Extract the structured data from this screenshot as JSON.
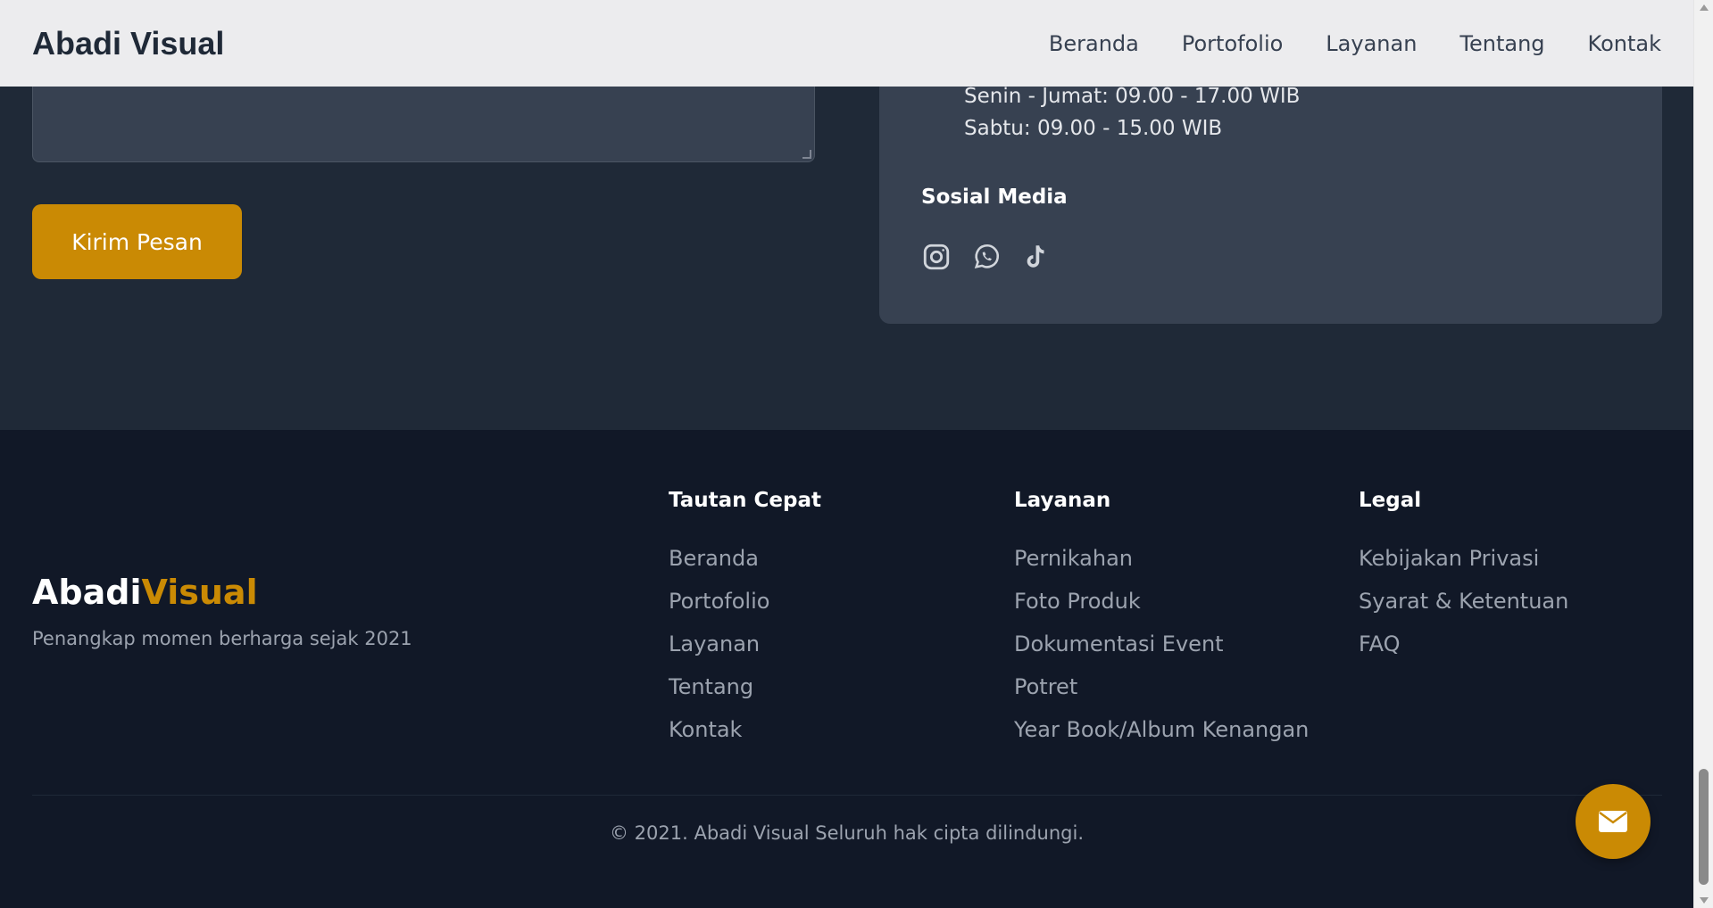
{
  "header": {
    "brand": "Abadi Visual",
    "nav": [
      "Beranda",
      "Portofolio",
      "Layanan",
      "Tentang",
      "Kontak"
    ]
  },
  "contact": {
    "send_button": "Kirim Pesan",
    "hours": [
      "Senin - Jumat: 09.00 - 17.00 WIB",
      "Sabtu: 09.00 - 15.00 WIB"
    ],
    "social_title": "Sosial Media",
    "social_icons": [
      "instagram-icon",
      "whatsapp-icon",
      "tiktok-icon"
    ]
  },
  "footer": {
    "brand_main": "Abadi",
    "brand_accent": "Visual",
    "tagline": "Penangkap momen berharga sejak 2021",
    "quick_links": {
      "title": "Tautan Cepat",
      "items": [
        "Beranda",
        "Portofolio",
        "Layanan",
        "Tentang",
        "Kontak"
      ]
    },
    "services": {
      "title": "Layanan",
      "items": [
        "Pernikahan",
        "Foto Produk",
        "Dokumentasi Event",
        "Potret",
        "Year Book/Album Kenangan"
      ]
    },
    "legal": {
      "title": "Legal",
      "items": [
        "Kebijakan Privasi",
        "Syarat & Ketentuan",
        "FAQ"
      ]
    },
    "copyright": "© 2021. Abadi Visual Seluruh hak cipta dilindungi."
  },
  "fab": {
    "icon": "envelope-icon"
  },
  "colors": {
    "accent": "#ca8a04",
    "section_bg": "#1f2937",
    "footer_bg": "#111827",
    "card_bg": "#374151",
    "header_bg": "#ececee"
  }
}
